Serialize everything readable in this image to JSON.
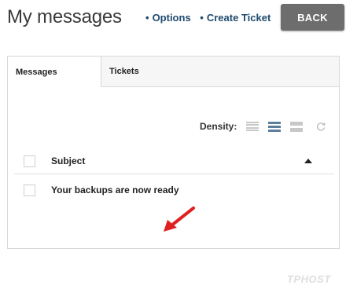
{
  "page": {
    "title": "My messages"
  },
  "header": {
    "links": [
      {
        "label": "Options"
      },
      {
        "label": "Create Ticket"
      }
    ],
    "back_label": "BACK"
  },
  "tabs": [
    {
      "label": "Messages",
      "active": true
    },
    {
      "label": "Tickets",
      "active": false
    }
  ],
  "density": {
    "label": "Density:",
    "options": [
      "compact-icon",
      "medium-icon",
      "large-icon"
    ],
    "selected": "medium",
    "refresh_icon": "refresh-icon"
  },
  "table": {
    "header": {
      "subject": "Subject",
      "sort": "ascending"
    },
    "rows": [
      {
        "subject": "Your backups are now ready"
      }
    ]
  },
  "annotation": {
    "arrow_color": "#e02020"
  },
  "watermark": {
    "text": "TPHOST"
  },
  "colors": {
    "accent": "#1f4a6e",
    "back_button": "#6d6d6d",
    "density_selected": "#5e7e9c"
  }
}
